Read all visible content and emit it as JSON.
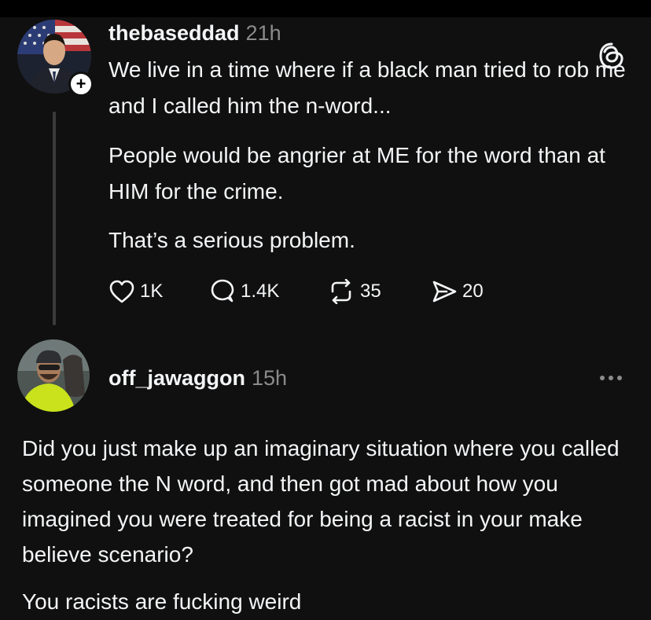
{
  "post": {
    "username": "thebaseddad",
    "time": "21h",
    "text": [
      "We live in a time where if a black man tried to rob me and I called him the n-word...",
      "People would be angrier at ME for the word than at HIM for the crime.",
      "That’s a serious problem."
    ],
    "follow_icon": "+",
    "stats": {
      "likes": "1K",
      "replies": "1.4K",
      "reposts": "35",
      "shares": "20"
    }
  },
  "reply": {
    "username": "off_jawaggon",
    "time": "15h",
    "text": [
      "Did you just make up an imaginary situation where you called someone the N word, and then got mad about how you imagined you were treated for being a racist in your make believe scenario?",
      "You racists are fucking weird"
    ]
  },
  "icons": [
    "threads-logo-icon",
    "heart-icon",
    "comment-icon",
    "repost-icon",
    "share-icon",
    "more-icon",
    "plus-icon"
  ],
  "colors": {
    "background": "#101010",
    "text": "#f3f5f7",
    "muted": "#8b8b8b",
    "thread_line": "#3b3b3b"
  }
}
